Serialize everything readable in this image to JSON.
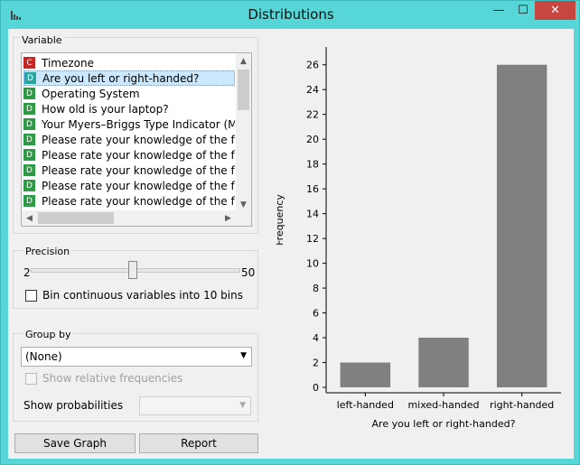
{
  "window": {
    "title": "Distributions",
    "minimize_glyph": "—",
    "maximize_glyph": "☐",
    "close_glyph": "✕",
    "accent_color": "#56d6d6"
  },
  "variable_box": {
    "label": "Variable",
    "items": [
      {
        "badge": "C",
        "label": "Timezone",
        "selected": false
      },
      {
        "badge": "D",
        "label": "Are you left or right-handed?",
        "selected": true
      },
      {
        "badge": "D",
        "label": "Operating System",
        "selected": false
      },
      {
        "badge": "D",
        "label": "How old is your laptop?",
        "selected": false
      },
      {
        "badge": "D",
        "label": "Your Myers–Briggs Type Indicator (MBTI)",
        "selected": false
      },
      {
        "badge": "D",
        "label": "Please rate your knowledge of the follow",
        "selected": false
      },
      {
        "badge": "D",
        "label": "Please rate your knowledge of the follow",
        "selected": false
      },
      {
        "badge": "D",
        "label": "Please rate your knowledge of the follow",
        "selected": false
      },
      {
        "badge": "D",
        "label": "Please rate your knowledge of the follow",
        "selected": false
      },
      {
        "badge": "D",
        "label": "Please rate your knowledge of the follow",
        "selected": false
      }
    ]
  },
  "precision_box": {
    "label": "Precision",
    "min_label": "2",
    "max_label": "50",
    "bin_checkbox_label": "Bin continuous variables into 10 bins",
    "bin_checked": false
  },
  "group_box": {
    "label": "Group by",
    "group_value": "(None)",
    "relative_label": "Show relative frequencies",
    "relative_checked": false,
    "probabilities_label": "Show probabilities",
    "probabilities_value": ""
  },
  "buttons": {
    "save_graph": "Save Graph",
    "report": "Report"
  },
  "chart_data": {
    "type": "bar",
    "categories": [
      "left-handed",
      "mixed-handed",
      "right-handed"
    ],
    "values": [
      2,
      4,
      26
    ],
    "xlabel": "Are you left or right-handed?",
    "ylabel": "Frequency",
    "ylim": [
      0,
      27
    ],
    "yticks": [
      0,
      2,
      4,
      6,
      8,
      10,
      12,
      14,
      16,
      18,
      20,
      22,
      24,
      26
    ],
    "bar_color": "#808080",
    "grid": false
  }
}
